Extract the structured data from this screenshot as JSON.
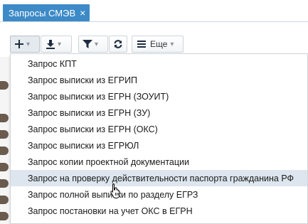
{
  "tab": {
    "label": "Запросы СМЭВ",
    "close": "×"
  },
  "toolbar": {
    "add_icon": "plus-icon",
    "download_icon": "download-icon",
    "filter_icon": "filter-icon",
    "refresh_icon": "refresh-icon",
    "menu_icon": "hamburger-icon",
    "more_label": "Еще",
    "caret": "⌄"
  },
  "menu": {
    "items": [
      "Запрос КПТ",
      "Запрос выписки из ЕГРИП",
      "Запрос выписки из ЕГРН (ЗОУИТ)",
      "Запрос выписки из ЕГРН (ЗУ)",
      "Запрос выписки из ЕГРН (ОКС)",
      "Запрос выписки из ЕГРЮЛ",
      "Запрос копии проектной документации",
      "Запрос на проверку действительности паспорта гражданина РФ",
      "Запрос полной выписки по разделу ЕГРЗ",
      "Запрос постановки на учет ОКС в ЕГРН"
    ],
    "hovered_index": 7
  },
  "colors": {
    "tab_bg": "#3d8ac7",
    "hover_bg": "#dde6ee",
    "icon": "#1e2e40"
  }
}
